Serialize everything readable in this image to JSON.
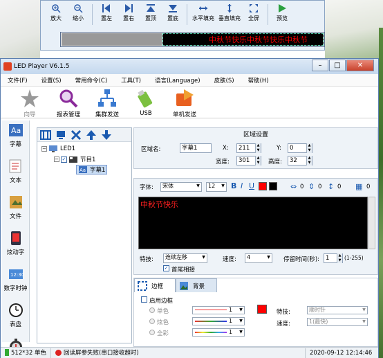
{
  "preview_toolbar": {
    "buttons": [
      {
        "label": "放大",
        "icon": "zoom-in-icon"
      },
      {
        "label": "缩小",
        "icon": "zoom-out-icon"
      },
      {
        "label": "置左",
        "icon": "align-left-icon"
      },
      {
        "label": "置右",
        "icon": "align-right-icon"
      },
      {
        "label": "置顶",
        "icon": "align-top-icon"
      },
      {
        "label": "置底",
        "icon": "align-bottom-icon"
      },
      {
        "label": "水平填充",
        "icon": "fill-horizontal-icon"
      },
      {
        "label": "垂直填充",
        "icon": "fill-vertical-icon"
      },
      {
        "label": "全屏",
        "icon": "fullscreen-icon"
      },
      {
        "label": "预览",
        "icon": "play-icon"
      }
    ],
    "preview_text": "中秋节快乐中秋节快乐中秋节"
  },
  "window": {
    "title": "LED Player V6.1.5",
    "controls": {
      "minimize": "–",
      "maximize": "□",
      "close": "✕"
    }
  },
  "menu": [
    "文件(F)",
    "设置(S)",
    "常用命令(C)",
    "工具(T)",
    "语言(Language)",
    "皮肤(S)",
    "帮助(H)"
  ],
  "toolbar": [
    {
      "label": "向导",
      "icon": "wizard-icon",
      "enabled": false
    },
    {
      "label": "报表管理",
      "icon": "magnifier-icon",
      "enabled": true
    },
    {
      "label": "集群发送",
      "icon": "network-icon",
      "enabled": true
    },
    {
      "label": "USB",
      "icon": "usb-icon",
      "enabled": true
    },
    {
      "label": "单机发送",
      "icon": "send-icon",
      "enabled": true
    }
  ],
  "sidebar": [
    {
      "label": "字幕",
      "icon": "subtitle-icon"
    },
    {
      "label": "文本",
      "icon": "text-icon"
    },
    {
      "label": "文件",
      "icon": "file-icon"
    },
    {
      "label": "炫动字",
      "icon": "animated-text-icon"
    },
    {
      "label": "数字时钟",
      "icon": "digital-clock-icon"
    },
    {
      "label": "表盘",
      "icon": "dial-icon"
    },
    {
      "label": "计时",
      "icon": "timer-icon"
    }
  ],
  "tree": {
    "root": "LED1",
    "program": "节目1",
    "item": "字幕1"
  },
  "region": {
    "title": "区域设置",
    "name_label": "区域名:",
    "name_value": "字幕1",
    "x_label": "X:",
    "x_value": "211",
    "y_label": "Y:",
    "y_value": "0",
    "width_label": "宽度:",
    "width_value": "301",
    "height_label": "高度:",
    "height_value": "32"
  },
  "editor": {
    "font_label": "字体:",
    "font_value": "宋体",
    "size_value": "12",
    "bold": "B",
    "italic": "I",
    "underline": "U",
    "spacing1": "0",
    "spacing2": "0",
    "spacing3": "0",
    "text": "中秋节快乐",
    "effect_label": "特技:",
    "effect_value": "连续左移",
    "speed_label": "速度:",
    "speed_value": "4",
    "stay_label": "停留时间(秒):",
    "stay_value": "1",
    "stay_range": "(1-255)",
    "head_tail_label": "首尾相接",
    "color_red": "#ff0000",
    "color_black": "#000000"
  },
  "border_panel": {
    "tab_border": "边框",
    "tab_background": "背景",
    "enable_label": "启用边框",
    "mono_label": "单色",
    "multi_label": "炫色",
    "full_label": "全彩",
    "value": "1",
    "effect_label": "特技:",
    "effect_value": "顺时针",
    "speed_label": "速度:",
    "speed_value": "1(最快)"
  },
  "status": {
    "resolution": "512*32 单色",
    "message": "回读屏参失败(串口接收超时)",
    "datetime": "2020-09-12 12:14:46"
  }
}
